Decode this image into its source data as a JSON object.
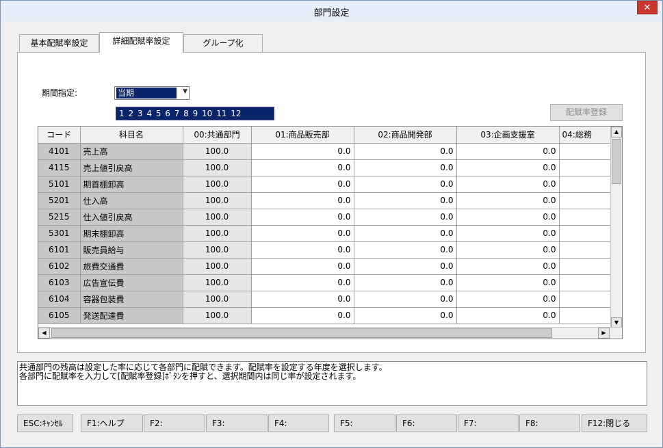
{
  "window": {
    "title": "部門設定",
    "close_glyph": "✕"
  },
  "tabs": [
    {
      "label": "基本配賦率設定",
      "active": false
    },
    {
      "label": "詳細配賦率設定",
      "active": true
    },
    {
      "label": "グループ化",
      "active": false
    }
  ],
  "period": {
    "label": "期間指定:",
    "value": "当期",
    "months": "1 2 3 4 5 6 7 8 9 10 11 12"
  },
  "register_button": "配賦率登録",
  "grid": {
    "headers": [
      "コード",
      "科目名",
      "00:共通部門",
      "01:商品販売部",
      "02:商品開発部",
      "03:企画支援室",
      "04:総務"
    ],
    "rows": [
      {
        "code": "4101",
        "name": "売上高",
        "common": "100.0",
        "d1": "0.0",
        "d2": "0.0",
        "d3": "0.0"
      },
      {
        "code": "4115",
        "name": "売上値引戻高",
        "common": "100.0",
        "d1": "0.0",
        "d2": "0.0",
        "d3": "0.0"
      },
      {
        "code": "5101",
        "name": "期首棚卸高",
        "common": "100.0",
        "d1": "0.0",
        "d2": "0.0",
        "d3": "0.0"
      },
      {
        "code": "5201",
        "name": "仕入高",
        "common": "100.0",
        "d1": "0.0",
        "d2": "0.0",
        "d3": "0.0"
      },
      {
        "code": "5215",
        "name": "仕入値引戻高",
        "common": "100.0",
        "d1": "0.0",
        "d2": "0.0",
        "d3": "0.0"
      },
      {
        "code": "5301",
        "name": "期末棚卸高",
        "common": "100.0",
        "d1": "0.0",
        "d2": "0.0",
        "d3": "0.0"
      },
      {
        "code": "6101",
        "name": "販売員給与",
        "common": "100.0",
        "d1": "0.0",
        "d2": "0.0",
        "d3": "0.0"
      },
      {
        "code": "6102",
        "name": "旅費交通費",
        "common": "100.0",
        "d1": "0.0",
        "d2": "0.0",
        "d3": "0.0"
      },
      {
        "code": "6103",
        "name": "広告宣伝費",
        "common": "100.0",
        "d1": "0.0",
        "d2": "0.0",
        "d3": "0.0"
      },
      {
        "code": "6104",
        "name": "容器包装費",
        "common": "100.0",
        "d1": "0.0",
        "d2": "0.0",
        "d3": "0.0"
      },
      {
        "code": "6105",
        "name": "発送配達費",
        "common": "100.0",
        "d1": "0.0",
        "d2": "0.0",
        "d3": "0.0"
      }
    ]
  },
  "message": {
    "line1": "共通部門の残高は設定した率に応じて各部門に配賦できます。配賦率を設定する年度を選択します。",
    "line2": "各部門に配賦率を入力して[配賦率登録]ﾎﾞﾀﾝを押すと、選択期間内は同じ率が設定されます。"
  },
  "function_keys": [
    "ESC:ｷｬﾝｾﾙ",
    "F1:ヘルプ",
    "F2:",
    "F3:",
    "F4:",
    "F5:",
    "F6:",
    "F7:",
    "F8:",
    "F12:閉じる"
  ]
}
